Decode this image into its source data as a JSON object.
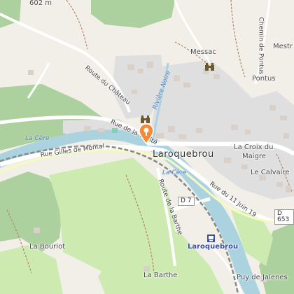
{
  "elevation": "602 m",
  "places": {
    "messac": "Messac",
    "mestr": "Mestr",
    "pontus": "Pontus",
    "laroquebrou": "Laroquebrou",
    "la_croix_du_maigre_1": "La Croix du",
    "la_croix_du_maigre_2": "Maigre",
    "le_calvaire": "Le Calvaire",
    "la_bouriot": "La Bouriot",
    "la_barthe": "La Barthe",
    "puy_de_jalenes": "Puy de Jalenes"
  },
  "roads": {
    "route_du_chateau": "Route du Château",
    "chemin_de_pontus": "Chemin de Pontus",
    "rue_de_la_trinite": "Rue de la Trinité",
    "rue_gilles_de_montal": "Rue Gilles de Montal",
    "route_de_la_barthe": "Route de la Barthe",
    "rue_du_11_juin": "Rue du 11 Juin 19",
    "d7": "D 7",
    "d653": "D 653"
  },
  "water": {
    "la_cere_west": "La Cère",
    "la_cere_mid": "La Cère",
    "riviere_noire": "Rivière Noire"
  },
  "station": "Laroquebrou",
  "colors": {
    "forest": "#add19e",
    "meadow": "#cdebb0",
    "river": "#aad3df",
    "residential": "#e0dfdf",
    "marker": "#f28a3a",
    "station": "#3b4fa0"
  },
  "icons": {
    "marker": "location-pin-icon",
    "viewpoint": "binoculars-icon",
    "station": "train-station-icon"
  }
}
